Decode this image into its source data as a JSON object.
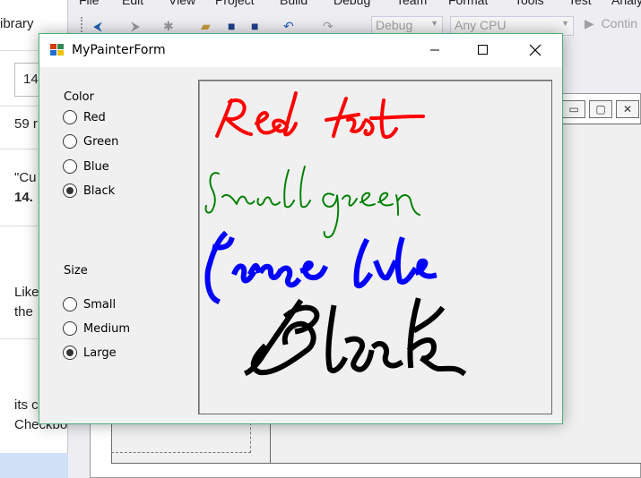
{
  "browser_bg": {
    "items": [
      "ibrary",
      "14",
      "59 r",
      "\"Cu",
      "14.",
      "Like",
      "the",
      "its c",
      "Checkbo"
    ]
  },
  "vs": {
    "menu": [
      "File",
      "Edit",
      "View",
      "Project",
      "Build",
      "Debug",
      "Team",
      "Format",
      "Tools",
      "Test",
      "Analy"
    ],
    "config_combo": "Debug",
    "platform_combo": "Any CPU",
    "continue_label": "Contin"
  },
  "form": {
    "title": "MyPainterForm",
    "color_group": {
      "label": "Color",
      "options": [
        {
          "label": "Red",
          "checked": false
        },
        {
          "label": "Green",
          "checked": false
        },
        {
          "label": "Blue",
          "checked": false
        },
        {
          "label": "Black",
          "checked": true
        }
      ]
    },
    "size_group": {
      "label": "Size",
      "options": [
        {
          "label": "Small",
          "checked": false
        },
        {
          "label": "Medium",
          "checked": false
        },
        {
          "label": "Large",
          "checked": true
        }
      ]
    },
    "drawing": {
      "strokes": [
        {
          "handwriting": "Red text",
          "color": "#ff0000",
          "pen_size": "Medium"
        },
        {
          "handwriting": "Small green",
          "color": "#008000",
          "pen_size": "Small"
        },
        {
          "handwriting": "Large blue",
          "color": "#0000ff",
          "pen_size": "Large"
        },
        {
          "handwriting": "Black",
          "color": "#000000",
          "pen_size": "Large"
        }
      ]
    }
  },
  "colors": {
    "window_border": "#4cb080",
    "form_bg": "#f0f0f0",
    "red": "#ff0000",
    "green": "#008000",
    "blue": "#0000ff",
    "black": "#000000"
  }
}
